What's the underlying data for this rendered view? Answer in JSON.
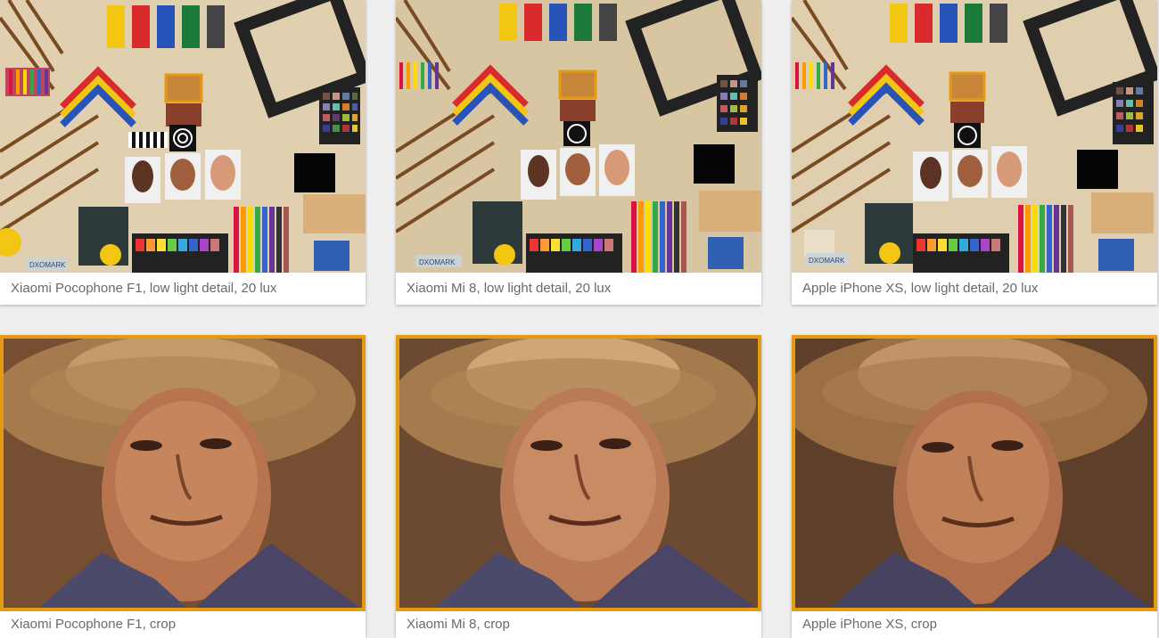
{
  "colors": {
    "accent": "#e49b12",
    "caption_text": "#6a6a6a",
    "background": "#eeeeee"
  },
  "cards": [
    {
      "caption": "Xiaomi Pocophone F1, low light detail, 20 lux",
      "image": "scene"
    },
    {
      "caption": "Xiaomi Mi 8, low light detail, 20 lux",
      "image": "scene"
    },
    {
      "caption": "Apple iPhone XS, low light detail, 20 lux",
      "image": "scene"
    },
    {
      "caption": "Xiaomi Pocophone F1, crop",
      "image": "crop"
    },
    {
      "caption": "Xiaomi Mi 8, crop",
      "image": "crop"
    },
    {
      "caption": "Apple iPhone XS, crop",
      "image": "crop"
    }
  ],
  "scene_watermark": "DXOMARK"
}
